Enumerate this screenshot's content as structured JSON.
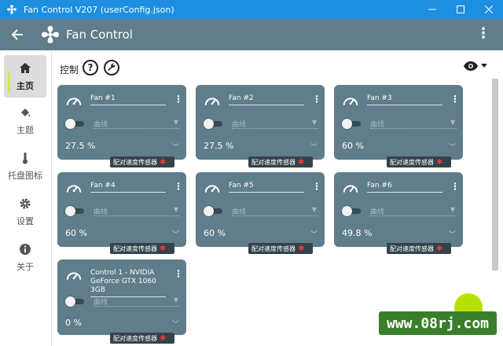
{
  "window": {
    "title": "Fan Control V207 (userConfig.json)"
  },
  "header": {
    "title": "Fan Control"
  },
  "sidebar": {
    "items": [
      {
        "label": "主页",
        "icon": "home-icon"
      },
      {
        "label": "主题",
        "icon": "paint-bucket-icon"
      },
      {
        "label": "托盘图标",
        "icon": "thermometer-icon"
      },
      {
        "label": "设置",
        "icon": "gear-icon"
      },
      {
        "label": "关于",
        "icon": "info-icon"
      }
    ]
  },
  "section": {
    "title": "控制",
    "help": "?"
  },
  "cards": [
    {
      "name": "Fan #1",
      "curve": "曲线",
      "value": "27.5 %",
      "pair": "配对速度传感器"
    },
    {
      "name": "Fan #2",
      "curve": "曲线",
      "value": "27.5 %",
      "pair": "配对速度传感器"
    },
    {
      "name": "Fan #3",
      "curve": "曲线",
      "value": "60 %",
      "pair": "配对速度传感器"
    },
    {
      "name": "Fan #4",
      "curve": "曲线",
      "value": "60 %",
      "pair": "配对速度传感器"
    },
    {
      "name": "Fan #5",
      "curve": "曲线",
      "value": "60 %",
      "pair": "配对速度传感器"
    },
    {
      "name": "Fan #6",
      "curve": "曲线",
      "value": "49.8 %",
      "pair": "配对速度传感器"
    },
    {
      "name": "Control 1 - NVIDIA GeForce GTX 1060 3GB",
      "curve": "曲线",
      "value": "0 %",
      "pair": "配对速度传感器"
    }
  ],
  "watermark": "www.08rj.com",
  "colors": {
    "titlebar": "#1e8fe0",
    "appbar": "#5f7d8a",
    "card": "#5f7d8a",
    "pair_x": "#e23c3c"
  }
}
